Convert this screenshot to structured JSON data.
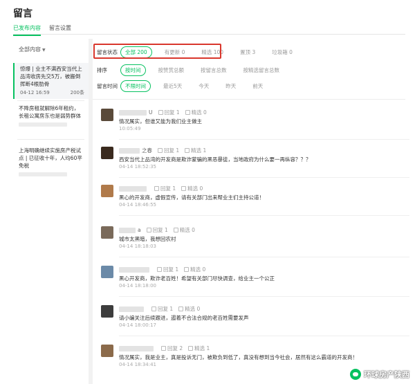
{
  "page": {
    "title": "留言"
  },
  "tabs": [
    {
      "label": "已发布内容",
      "active": true
    },
    {
      "label": "留言设置",
      "active": false
    }
  ],
  "left": {
    "filter": "全部内容",
    "articles": [
      {
        "title_lines": [
          "惊爆 | 业主不满西安当代上",
          "品湾收房先交5万，被搬倒",
          "挥断4根肋骨"
        ],
        "date": "04-12 16:59",
        "count": "200条",
        "active": true
      },
      {
        "title_lines": [
          "不降房租就解除6年租约，",
          "长租公寓房东也是弱势群体"
        ],
        "active": false
      },
      {
        "title_lines": [
          "上海明确继续实施房产税试",
          "点 | 已征收十年，人均60平",
          "免税"
        ],
        "active": false
      }
    ]
  },
  "filters": {
    "status": {
      "label": "留言状态",
      "options": [
        "全部 200",
        "有更新 0",
        "精选 100",
        "置顶 3",
        "垃圾箱 0"
      ]
    },
    "sort": {
      "label": "排序",
      "options": [
        "按时间",
        "按赞赏总额",
        "按留言总数",
        "按精选留言总数"
      ]
    },
    "time": {
      "label": "留言时间",
      "options": [
        "不限时间",
        "最近5天",
        "今天",
        "昨天",
        "前天"
      ]
    }
  },
  "comments": [
    {
      "name": "U",
      "reply": "回复 1",
      "select": "精选 0",
      "text": "情况属实，但谁又能为我们业主做主",
      "time": "10:05:49",
      "avatar_color": "#5a4a3a"
    },
    {
      "name": "之春",
      "reply": "回复 1",
      "select": "精选 1",
      "text": "西安当代上品湾的开发商是欺诈蒙骗的黑恶暴徒，当地政府为什么要一再纵容？？？",
      "time": "04-14 18:52:35",
      "avatar_color": "#3a2a1e"
    },
    {
      "name": "",
      "reply": "回复 1",
      "select": "精选 0",
      "text": "黑心的开发商，虚假宣传，请有关部门出来帮业主们主持公道！",
      "time": "04-14 18:46:55",
      "avatar_color": "#b07a4a"
    },
    {
      "name": "a",
      "reply": "回复 1",
      "select": "精选 0",
      "text": "城市太黑暗，我想回农村",
      "time": "04-14 18:18:03",
      "avatar_color": "#7a6a5a"
    },
    {
      "name": "",
      "reply": "回复 1",
      "select": "精选 0",
      "text": "黑心开发商，欺诈老百姓！希望有关部门尽快调查，给业主一个公正",
      "time": "04-14 18:18:00",
      "avatar_color": "#6b8aa8"
    },
    {
      "name": "",
      "reply": "回复 1",
      "select": "精选 0",
      "text": "请小编关注后续跟进，遏着不合法合规的老百姓需要发声",
      "time": "04-14 18:00:17",
      "avatar_color": "#3d3d3d"
    },
    {
      "name": "",
      "reply": "回复 2",
      "select": "精选 1",
      "text": "情况属实，我是业主，真是投诉无门，被欺负到低了，真没有想到当今社会，居然有这么霸道的开发商！",
      "time": "04-14 18:34:41",
      "avatar_color": "#8b6a4a"
    }
  ],
  "watermark": {
    "text": "环球房产陕西"
  }
}
